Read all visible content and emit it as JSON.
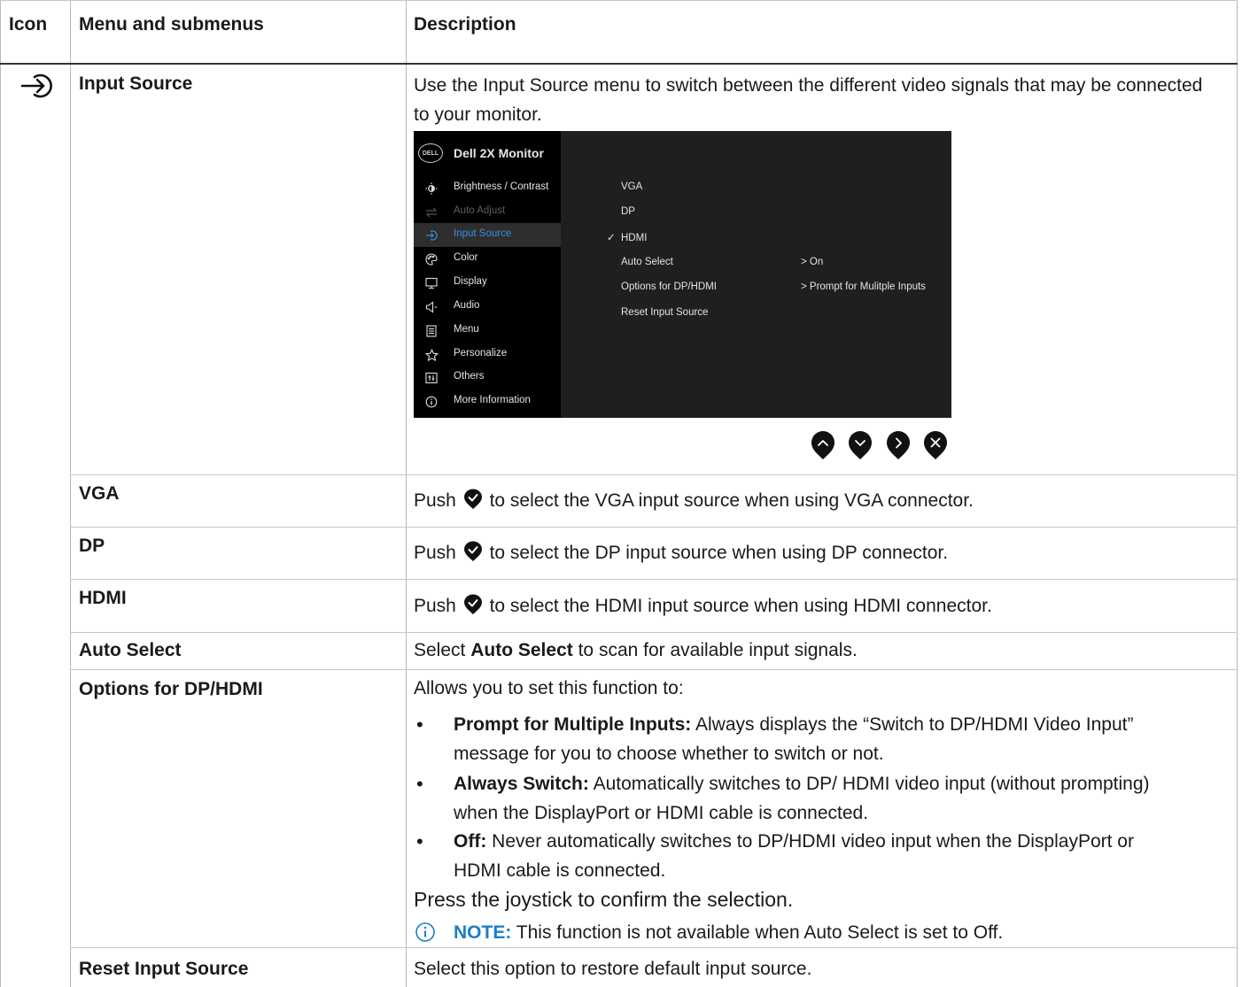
{
  "header": {
    "col_icon": "Icon",
    "col_menu": "Menu and submenus",
    "col_desc": "Description"
  },
  "rows": {
    "input_source": {
      "menu": "Input Source",
      "desc": "Use the Input Source menu to switch between the different video signals that may be connected to your monitor.",
      "icon": "input-source-icon"
    },
    "vga": {
      "menu": "VGA",
      "push": "Push",
      "desc": "to select the VGA input source when using VGA connector."
    },
    "dp": {
      "menu": "DP",
      "push": "Push",
      "desc": "to select the DP input source when using DP connector."
    },
    "hdmi": {
      "menu": "HDMI",
      "push": "Push",
      "desc": "to select the HDMI input source when using HDMI connector."
    },
    "auto_select": {
      "menu": "Auto Select",
      "pre": "Select",
      "bold": "Auto Select",
      "post": "to scan for available input signals."
    },
    "options": {
      "menu": "Options for DP/HDMI",
      "intro": "Allows you to set this function to:",
      "bullets": [
        {
          "bold": "Prompt for Multiple Inputs:",
          "text1": "Always displays the “Switch to DP/HDMI Video Input”",
          "text2": "message for you to choose whether to switch or not."
        },
        {
          "bold": "Always Switch:",
          "text1": "Automatically switches to DP/ HDMI video input (without prompting)",
          "text2": "when the DisplayPort or HDMI cable is connected."
        },
        {
          "bold": "Off:",
          "text1": "Never automatically switches to DP/HDMI video input when the DisplayPort or",
          "text2": "HDMI cable is connected."
        }
      ],
      "confirm": "Press the joystick to confirm the selection.",
      "note_label": "NOTE:",
      "note_text": "This function is not available when Auto Select is set to Off."
    },
    "reset": {
      "menu": "Reset Input Source",
      "desc": "Select this option to restore default input source."
    }
  },
  "osd": {
    "logo": "DELL",
    "title": "Dell 2X Monitor",
    "menu_items": [
      {
        "label": "Brightness / Contrast",
        "icon": "brightness-icon",
        "state": "normal"
      },
      {
        "label": "Auto Adjust",
        "icon": "auto-adjust-icon",
        "state": "dim"
      },
      {
        "label": "Input Source",
        "icon": "input-source-icon",
        "state": "selected"
      },
      {
        "label": "Color",
        "icon": "color-icon",
        "state": "normal"
      },
      {
        "label": "Display",
        "icon": "display-icon",
        "state": "normal"
      },
      {
        "label": "Audio",
        "icon": "audio-icon",
        "state": "normal"
      },
      {
        "label": "Menu",
        "icon": "menu-icon",
        "state": "normal"
      },
      {
        "label": "Personalize",
        "icon": "star-icon",
        "state": "normal"
      },
      {
        "label": "Others",
        "icon": "others-icon",
        "state": "normal"
      },
      {
        "label": "More Information",
        "icon": "info-icon",
        "state": "normal"
      }
    ],
    "options": {
      "vga": "VGA",
      "dp": "DP",
      "hdmi": "HDMI",
      "auto_select": "Auto Select",
      "auto_select_value": "> On",
      "options_dp_hdmi": "Options for DP/HDMI",
      "options_value": "> Prompt for Mulitple Inputs",
      "reset": "Reset Input Source"
    },
    "nav_buttons": [
      "up-button-icon",
      "down-button-icon",
      "right-button-icon",
      "exit-button-icon"
    ]
  },
  "colors": {
    "osd_bg": "#1f1f1f",
    "osd_left_bg": "#000000",
    "osd_accent": "#3a8ee6",
    "note_blue": "#1a7fc6"
  }
}
